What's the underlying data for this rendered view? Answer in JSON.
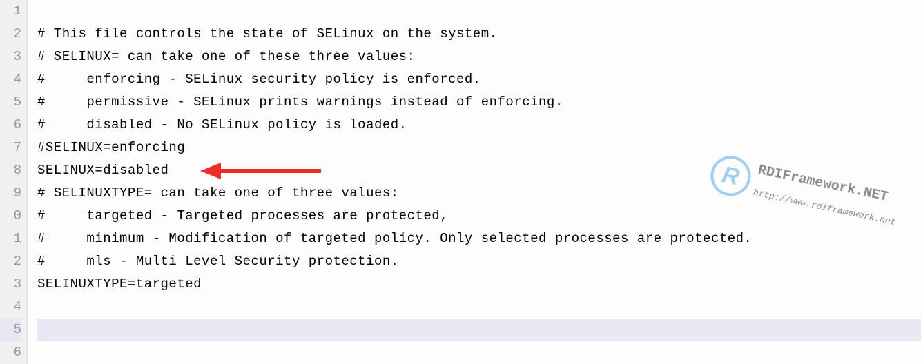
{
  "editor": {
    "lines": [
      {
        "num": "1",
        "text": ""
      },
      {
        "num": "2",
        "text": "# This file controls the state of SELinux on the system."
      },
      {
        "num": "3",
        "text": "# SELINUX= can take one of these three values:"
      },
      {
        "num": "4",
        "text": "#     enforcing - SELinux security policy is enforced."
      },
      {
        "num": "5",
        "text": "#     permissive - SELinux prints warnings instead of enforcing."
      },
      {
        "num": "6",
        "text": "#     disabled - No SELinux policy is loaded."
      },
      {
        "num": "7",
        "text": "#SELINUX=enforcing"
      },
      {
        "num": "8",
        "text": "SELINUX=disabled"
      },
      {
        "num": "9",
        "text": "# SELINUXTYPE= can take one of three values:"
      },
      {
        "num": "0",
        "text": "#     targeted - Targeted processes are protected,"
      },
      {
        "num": "1",
        "text": "#     minimum - Modification of targeted policy. Only selected processes are protected."
      },
      {
        "num": "2",
        "text": "#     mls - Multi Level Security protection."
      },
      {
        "num": "3",
        "text": "SELINUXTYPE=targeted"
      },
      {
        "num": "4",
        "text": ""
      },
      {
        "num": "5",
        "text": ""
      },
      {
        "num": "6",
        "text": ""
      }
    ],
    "current_line_index": 14
  },
  "watermark": {
    "badge_letter": "R",
    "title": "RDIFramework.NET",
    "url": "http://www.rdiframework.net"
  },
  "annotation": {
    "arrow_color": "#ee2e24"
  }
}
